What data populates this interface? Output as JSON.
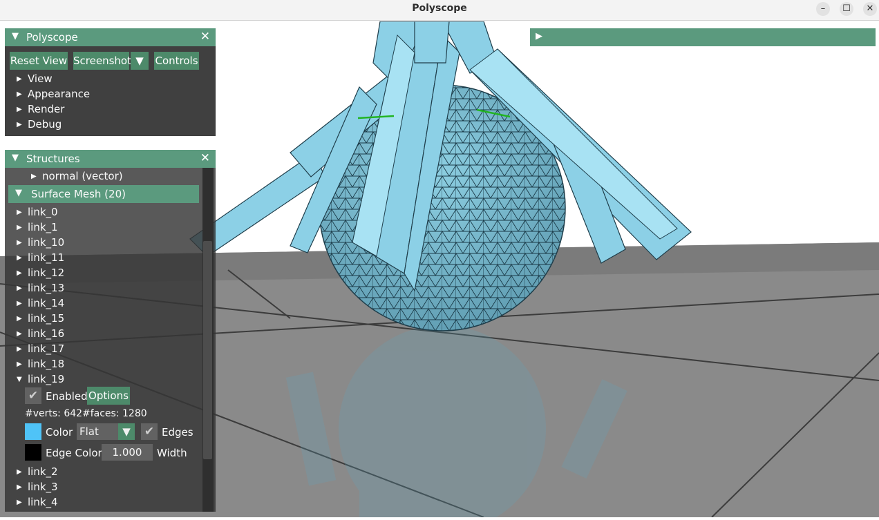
{
  "window": {
    "title": "Polyscope",
    "buttons": [
      "–",
      "☐",
      "✕"
    ]
  },
  "polyscope_panel": {
    "title": "Polyscope",
    "buttons": {
      "reset_view": "Reset View",
      "screenshot": "Screenshot",
      "controls": "Controls"
    },
    "sections": [
      "View",
      "Appearance",
      "Render",
      "Debug"
    ]
  },
  "structures_panel": {
    "title": "Structures",
    "normal_item": "normal (vector)",
    "surface_mesh_header": "Surface Mesh (20)",
    "links_before": [
      "link_0",
      "link_1",
      "link_10",
      "link_11",
      "link_12",
      "link_13",
      "link_14",
      "link_15",
      "link_16",
      "link_17",
      "link_18"
    ],
    "expanded": {
      "name": "link_19",
      "enabled_label": "Enabled",
      "options_label": "Options",
      "verts": "#verts: 642",
      "faces": "#faces: 1280",
      "color_label": "Color",
      "shade_mode": "Flat",
      "edges_label": "Edges",
      "edge_color_label": "Edge Color",
      "width_value": "1.000",
      "width_label": "Width"
    },
    "links_after": [
      "link_2",
      "link_3",
      "link_4"
    ]
  },
  "colors": {
    "mesh": "#4fc3f7",
    "edge": "#000000",
    "accent": "#5b9a7e"
  },
  "icons": {
    "collapsed": "triangle-right-icon",
    "expanded": "triangle-down-icon",
    "close": "close-icon",
    "check": "check-icon",
    "dropdown": "chevron-down-icon"
  }
}
